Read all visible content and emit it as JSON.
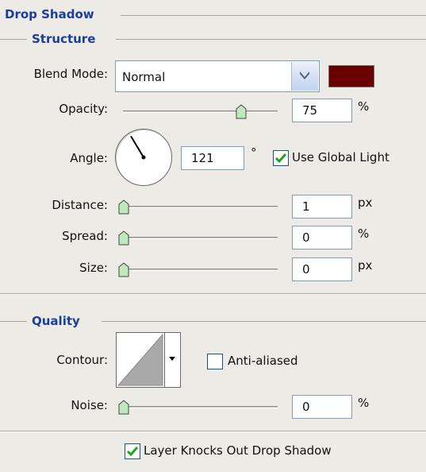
{
  "section_title": "Drop Shadow",
  "structure": {
    "title": "Structure",
    "blend_mode": {
      "label": "Blend Mode:",
      "value": "Normal",
      "color": "#6b0000"
    },
    "opacity": {
      "label": "Opacity:",
      "value": "75",
      "unit": "%",
      "level": 0.75
    },
    "angle": {
      "label": "Angle:",
      "value": "121",
      "unit": "°",
      "degrees": 121
    },
    "global_light": {
      "label": "Use Global Light",
      "checked": true
    },
    "distance": {
      "label": "Distance:",
      "value": "1",
      "unit": "px"
    },
    "spread": {
      "label": "Spread:",
      "value": "0",
      "unit": "%"
    },
    "size": {
      "label": "Size:",
      "value": "0",
      "unit": "px"
    }
  },
  "quality": {
    "title": "Quality",
    "contour": {
      "label": "Contour:"
    },
    "anti_aliased": {
      "label": "Anti-aliased",
      "checked": false
    },
    "noise": {
      "label": "Noise:",
      "value": "0",
      "unit": "%"
    }
  },
  "knockout": {
    "label": "Layer Knocks Out Drop Shadow",
    "checked": true
  },
  "colors": {
    "title": "#1c3d9a",
    "check": "#21a121",
    "thumb": "#bfe8bf"
  },
  "icons": [
    "chevron-down-icon",
    "angle-dial-icon",
    "slider-thumb-icon",
    "checkmark-icon",
    "contour-curve-icon"
  ]
}
